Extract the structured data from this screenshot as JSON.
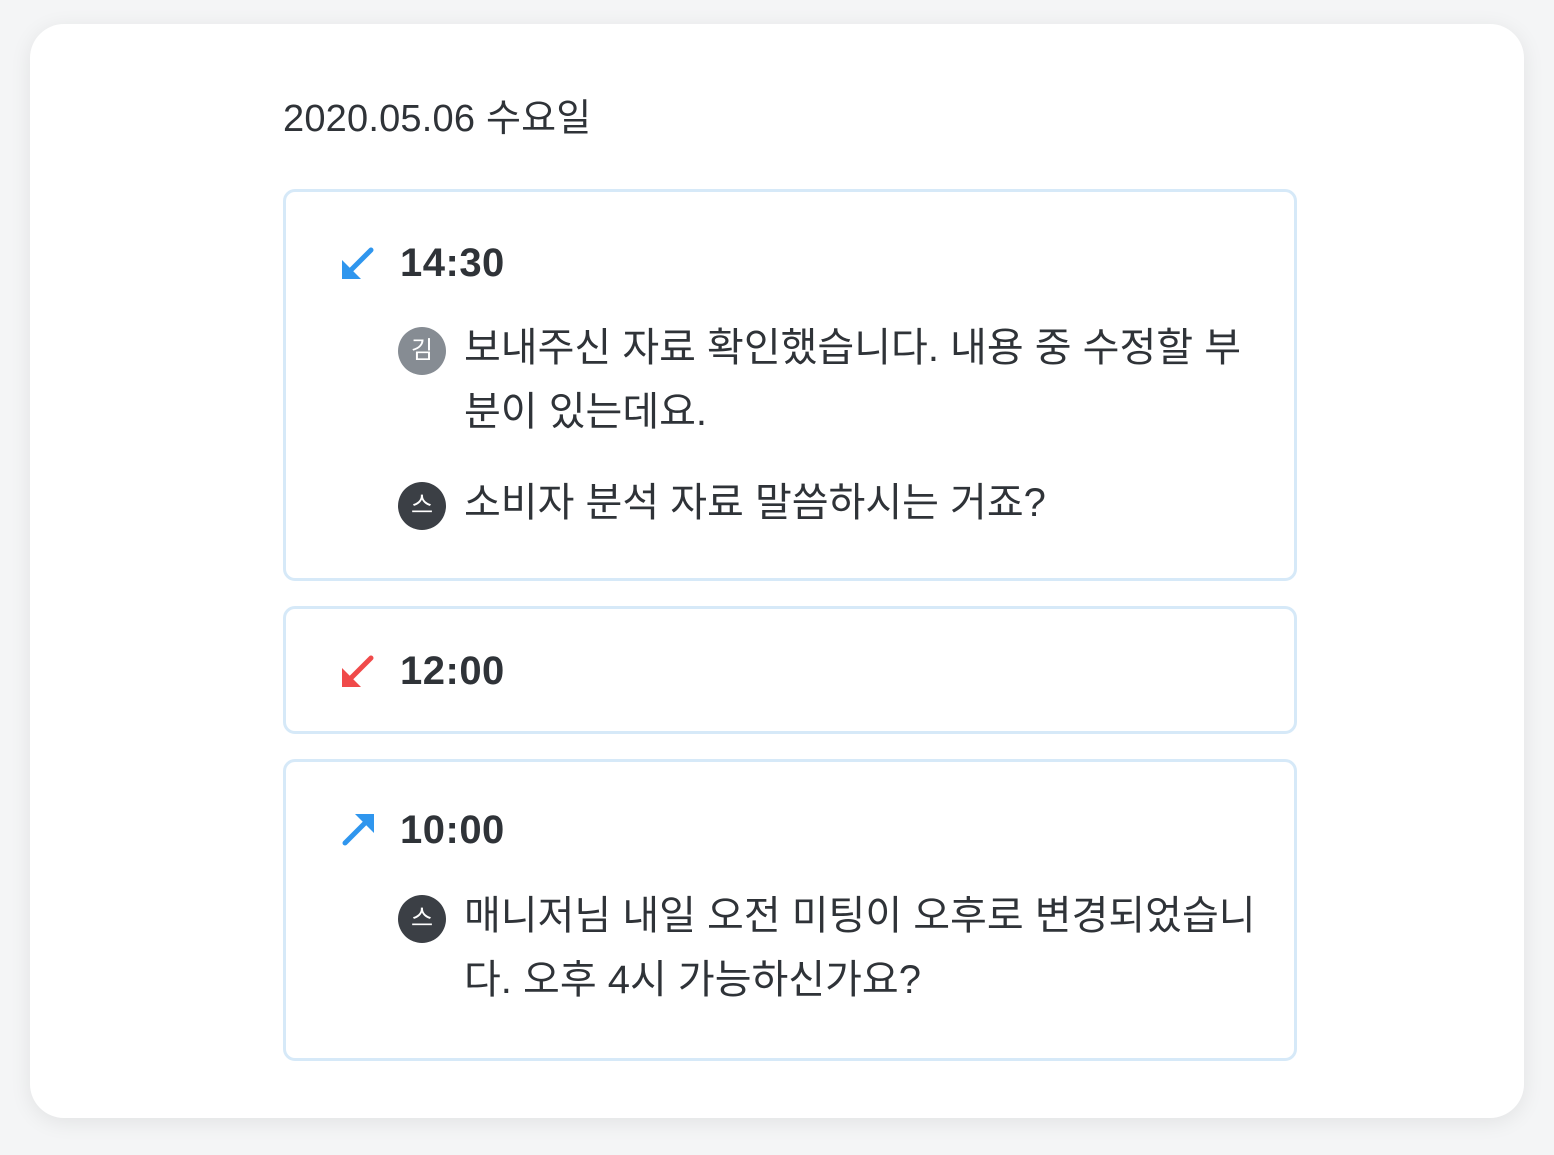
{
  "date_header": "2020.05.06 수요일",
  "entries": [
    {
      "time": "14:30",
      "direction_icon": "arrow-down-left-icon",
      "icon_color": "#2f96ee",
      "messages": [
        {
          "avatar": "김",
          "avatar_color": "#868c93",
          "text": "보내주신 자료 확인했습니다. 내용 중 수정할 부분이 있는데요."
        },
        {
          "avatar": "스",
          "avatar_color": "#3b3f45",
          "text": "소비자 분석 자료 말씀하시는 거죠?"
        }
      ]
    },
    {
      "time": "12:00",
      "direction_icon": "arrow-down-left-icon",
      "icon_color": "#f04a4a",
      "messages": []
    },
    {
      "time": "10:00",
      "direction_icon": "arrow-up-right-icon",
      "icon_color": "#2f96ee",
      "messages": [
        {
          "avatar": "스",
          "avatar_color": "#3b3f45",
          "text": "매니저님 내일 오전 미팅이 오후로 변경되었습니다. 오후 4시 가능하신가요?"
        }
      ]
    }
  ]
}
